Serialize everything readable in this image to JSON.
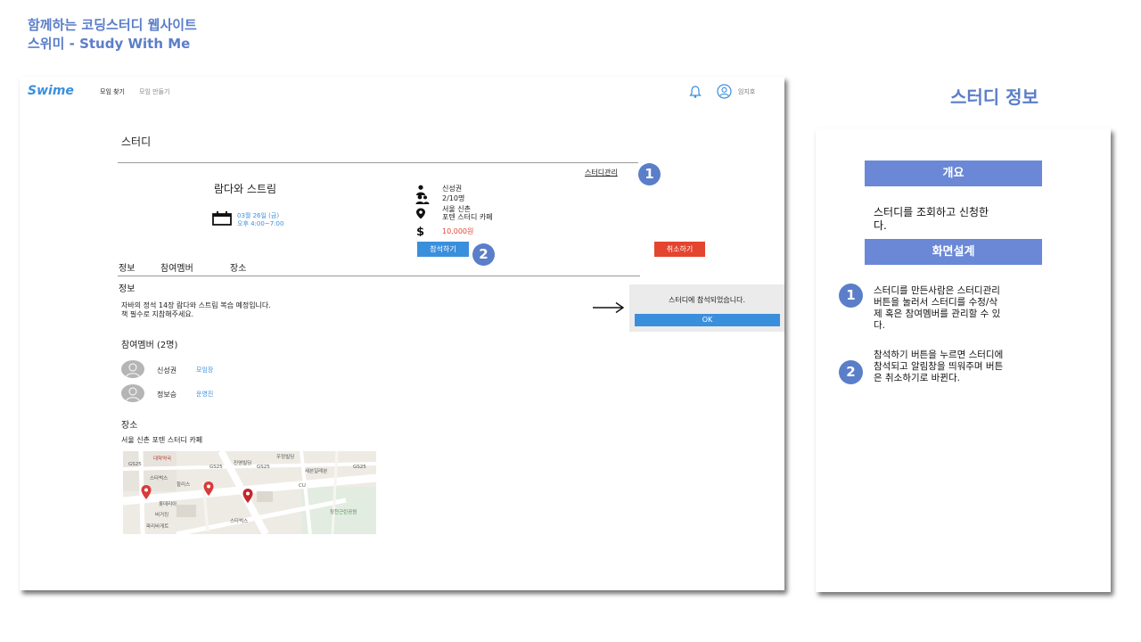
{
  "slide": {
    "title_line1": "함께하는 코딩스터디 웹사이트",
    "title_line2": "스위미 - Study With Me"
  },
  "app": {
    "logo": "Swime",
    "nav": [
      "모임 찾기",
      "모임 만들기"
    ],
    "username": "임지호",
    "icons": [
      "bell-icon",
      "user-icon"
    ]
  },
  "study": {
    "header": "스터디",
    "manage_link": "스터디관리",
    "title": "람다와 스트림",
    "date_line1": "03월 26일 (금)",
    "date_line2": "오후 4:00~7:00",
    "leader": "신성권",
    "members_count": "2/10명",
    "location_line1": "서울 신촌",
    "location_line2": "포텐 스터디 카페",
    "price": "10,000원",
    "join_button": "참석하기",
    "cancel_button": "취소하기"
  },
  "tabs": [
    "정보",
    "참여멤버",
    "장소"
  ],
  "info": {
    "heading": "정보",
    "text_line1": "자바의 정석 14장 람다와 스트림 복습 예정입니다.",
    "text_line2": "책 필수로 지참해주세요."
  },
  "members": {
    "heading": "참여멤버 (2명)",
    "list": [
      {
        "name": "신성권",
        "role": "모임장"
      },
      {
        "name": "정보승",
        "role": "운영진"
      }
    ]
  },
  "place": {
    "heading": "장소",
    "address": "서울 신촌 포텐 스터디 카페",
    "map_labels": [
      "GS25",
      "GS25",
      "GS25",
      "GS25",
      "CU",
      "스타벅스",
      "할리스",
      "롯데리아",
      "버거킹",
      "파리바게트",
      "스타벅스",
      "진영빌딩",
      "우정빌딩",
      "세븐일레븐",
      "대학약국",
      "창천근린공원"
    ]
  },
  "alert": {
    "message": "스터디에 참석되었습니다.",
    "ok": "OK"
  },
  "notes": {
    "screen_name": "스터디 정보",
    "overview_heading": "개요",
    "overview_text_line1": "스터디를 조회하고 신청한",
    "overview_text_line2": "다.",
    "design_heading": "화면설계",
    "item1_lines": [
      "스터디를 만든사람은 스터디관리",
      "버튼을 눌러서 스터디를 수정/삭",
      "제 혹은 참여멤버를 관리할 수 있",
      "다."
    ],
    "item2_lines": [
      "참석하기 버튼을 누르면 스터디에",
      "참석되고 알림창을 띄워주며 버튼",
      "은 취소하기로 바뀐다."
    ]
  },
  "badges": [
    "1",
    "2"
  ],
  "colors": {
    "accent": "#5b7ec9",
    "primary_button": "#3a8fdd",
    "danger_button": "#e3452f",
    "note_header": "#6a88d6"
  }
}
